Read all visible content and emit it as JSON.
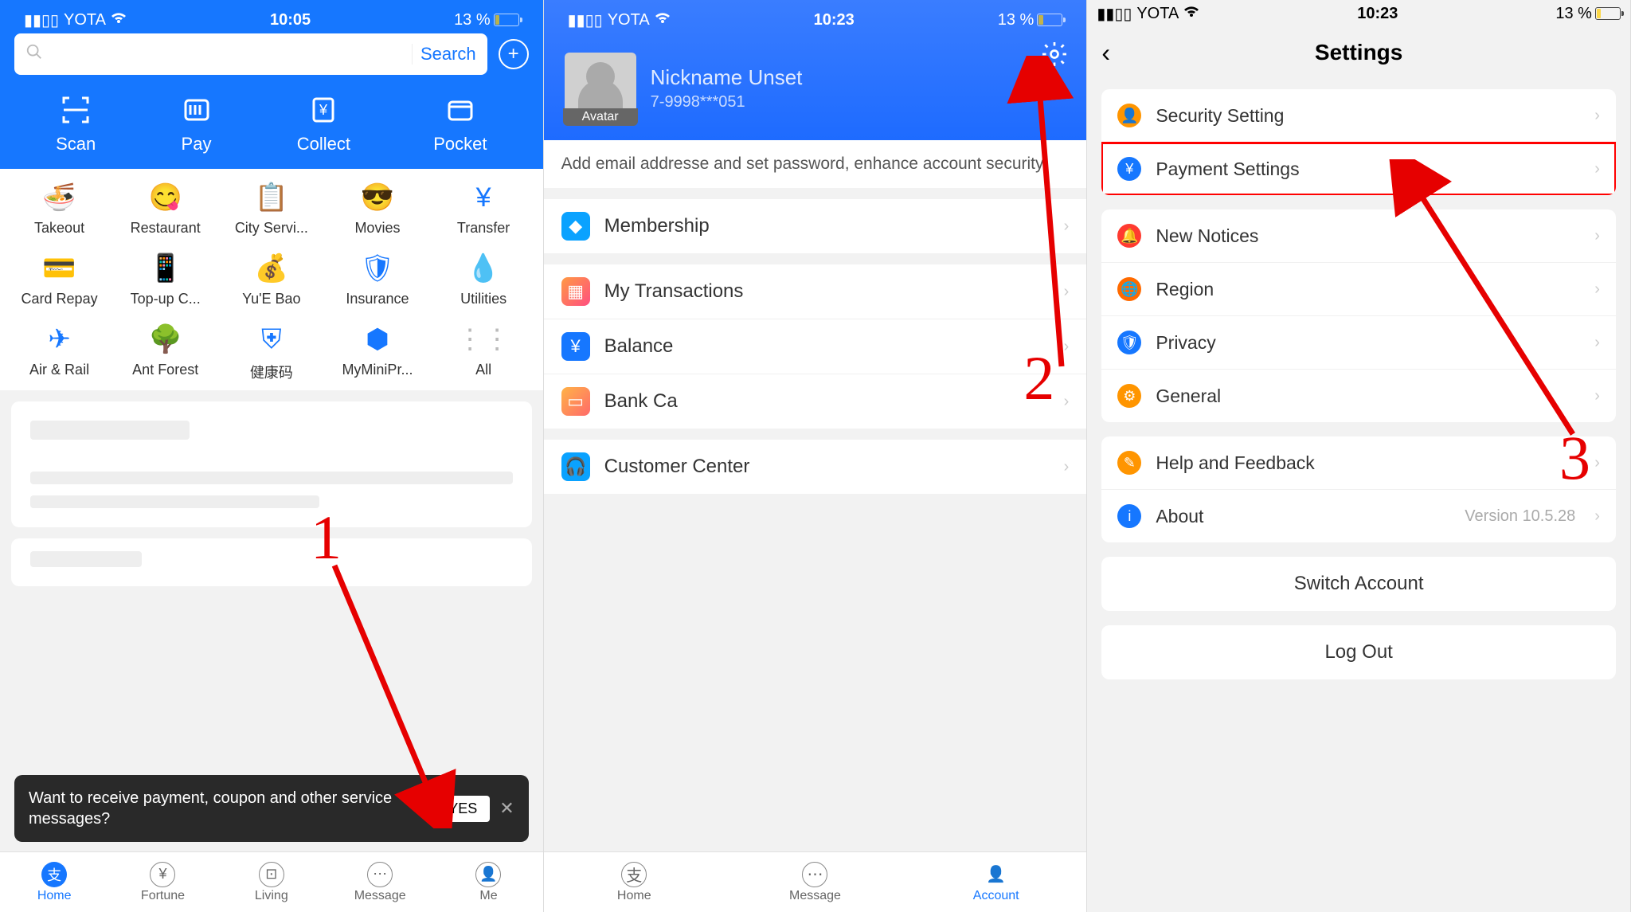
{
  "status": {
    "carrier": "YOTA",
    "time1": "10:05",
    "time2": "10:23",
    "time3": "10:23",
    "battery": "13 %"
  },
  "screen1": {
    "search_placeholder": "",
    "search_button": "Search",
    "quick": [
      {
        "label": "Scan"
      },
      {
        "label": "Pay"
      },
      {
        "label": "Collect"
      },
      {
        "label": "Pocket"
      }
    ],
    "grid": [
      {
        "label": "Takeout",
        "color": "#1677ff"
      },
      {
        "label": "Restaurant",
        "color": "#ff6a00"
      },
      {
        "label": "City Servi...",
        "color": "#1677ff"
      },
      {
        "label": "Movies",
        "color": "#ff6a00"
      },
      {
        "label": "Transfer",
        "color": "#1677ff"
      },
      {
        "label": "Card Repay",
        "color": "#ff6a00"
      },
      {
        "label": "Top-up C...",
        "color": "#ff6a00"
      },
      {
        "label": "Yu'E Bao",
        "color": "#ff3b30"
      },
      {
        "label": "Insurance",
        "color": "#1677ff"
      },
      {
        "label": "Utilities",
        "color": "#1677ff"
      },
      {
        "label": "Air & Rail",
        "color": "#1677ff"
      },
      {
        "label": "Ant Forest",
        "color": "#00aa33"
      },
      {
        "label": "健康码",
        "color": "#1677ff"
      },
      {
        "label": "MyMiniPr...",
        "color": "#1677ff"
      },
      {
        "label": "All",
        "color": "#bbb"
      }
    ],
    "toast": {
      "text": "Want to receive payment, coupon and other service messages?",
      "yes": "YES"
    },
    "tabs": [
      {
        "label": "Home"
      },
      {
        "label": "Fortune"
      },
      {
        "label": "Living"
      },
      {
        "label": "Message"
      },
      {
        "label": "Me"
      }
    ]
  },
  "screen2": {
    "nickname": "Nickname Unset",
    "account_num": "7-9998***051",
    "avatar_tag": "Avatar",
    "security_notice": "Add email addresse and set password, enhance account security",
    "rows": [
      {
        "label": "Membership",
        "ic_bg": "#0aa2ff"
      },
      {
        "label": "My Transactions",
        "ic_bg": "linear-gradient(135deg,#ff9a44,#ff4e80)"
      },
      {
        "label": "Balance",
        "ic_bg": "#1677ff"
      },
      {
        "label": "Bank Ca",
        "ic_bg": "linear-gradient(135deg,#ffb347,#ff6a6a)"
      },
      {
        "label": "Customer Center",
        "ic_bg": "#0aa2ff"
      }
    ],
    "tabs": [
      {
        "label": "Home"
      },
      {
        "label": "Message"
      },
      {
        "label": "Account"
      }
    ]
  },
  "screen3": {
    "title": "Settings",
    "groups": [
      [
        {
          "label": "Security Setting",
          "ic_bg": "#ff9500",
          "highlight": false
        },
        {
          "label": "Payment Settings",
          "ic_bg": "#1677ff",
          "highlight": true
        }
      ],
      [
        {
          "label": "New Notices",
          "ic_bg": "#ff3b30"
        },
        {
          "label": "Region",
          "ic_bg": "#ff6a00"
        },
        {
          "label": "Privacy",
          "ic_bg": "#1677ff"
        },
        {
          "label": "General",
          "ic_bg": "#ff9500"
        }
      ],
      [
        {
          "label": "Help and Feedback",
          "ic_bg": "#ff9500"
        },
        {
          "label": "About",
          "ic_bg": "#1677ff",
          "extra": "Version 10.5.28"
        }
      ]
    ],
    "switch_account": "Switch Account",
    "logout": "Log Out"
  },
  "annotations": {
    "num1": "1",
    "num2": "2",
    "num3": "3"
  }
}
